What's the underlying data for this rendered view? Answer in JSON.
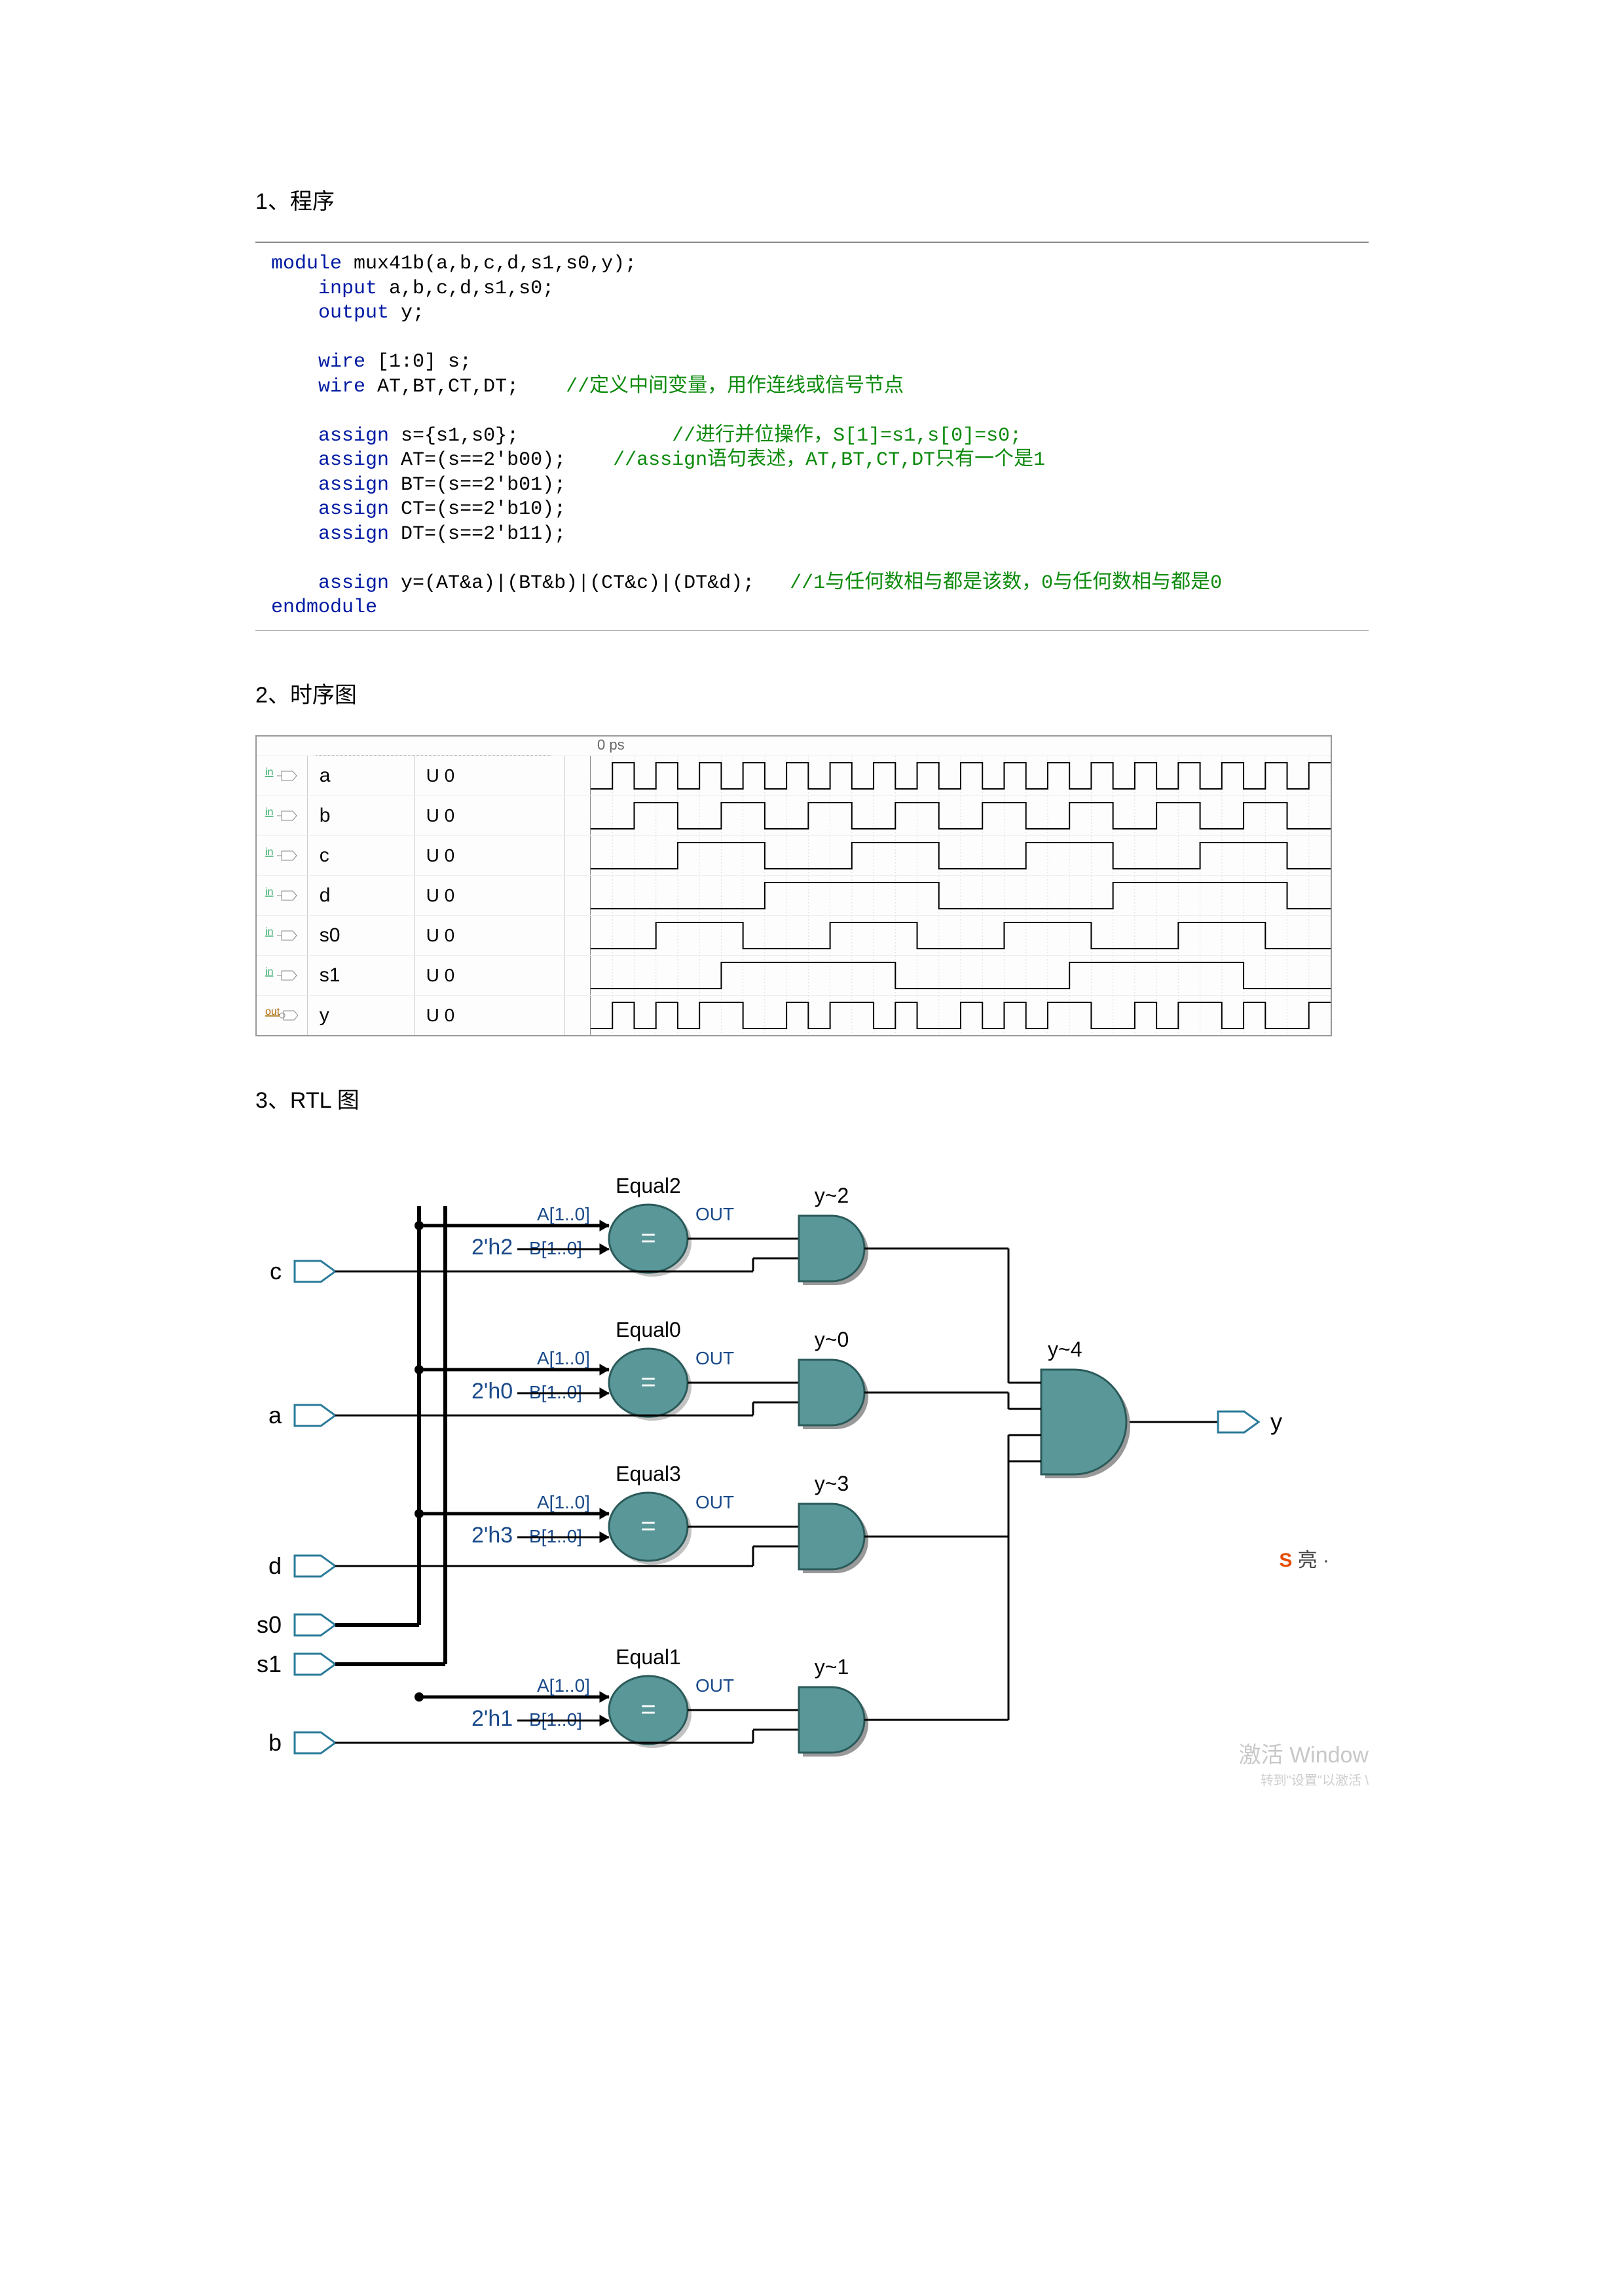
{
  "sections": {
    "s1": "1、程序",
    "s2": "2、时序图",
    "s3": "3、RTL 图"
  },
  "code": {
    "l1a": "module",
    "l1b": " mux41b(a,b,c,d,s1,s0,y);",
    "l2a": "input",
    "l2b": " a,b,c,d,s1,s0;",
    "l3a": "output",
    "l3b": " y;",
    "l4a": "wire",
    "l4b": " [1:0] s;",
    "l5a": "wire",
    "l5b": " AT,BT,CT,DT;    ",
    "l5c": "//定义中间变量，用作连线或信号节点",
    "l6a": "assign",
    "l6b": " s={s1,s0};             ",
    "l6c": "//进行并位操作，S[1]=s1,s[0]=s0;",
    "l7a": "assign",
    "l7b": " AT=(s==2'b00);    ",
    "l7c": "//assign语句表述，AT,BT,CT,DT只有一个是1",
    "l8a": "assign",
    "l8b": " BT=(s==2'b01);",
    "l9a": "assign",
    "l9b": " CT=(s==2'b10);",
    "l10a": "assign",
    "l10b": " DT=(s==2'b11);",
    "l11a": "assign",
    "l11b": " y=(AT&a)|(BT&b)|(CT&c)|(DT&d);   ",
    "l11c": "//1与任何数相与都是该数，0与任何数相与都是0",
    "l12": "endmodule"
  },
  "wave": {
    "time_label": "0 ps",
    "rows": [
      {
        "kind": "in",
        "name": "a",
        "val": "U 0",
        "period": 1,
        "phase": 0
      },
      {
        "kind": "in",
        "name": "b",
        "val": "U 0",
        "period": 2,
        "phase": 0
      },
      {
        "kind": "in",
        "name": "c",
        "val": "U 0",
        "period": 4,
        "phase": 0
      },
      {
        "kind": "in",
        "name": "d",
        "val": "U 0",
        "period": 8,
        "phase": 0
      },
      {
        "kind": "in",
        "name": "s0",
        "val": "U 0",
        "period": 4,
        "phase": 1
      },
      {
        "kind": "in",
        "name": "s1",
        "val": "U 0",
        "period": 8,
        "phase": 2
      },
      {
        "kind": "out",
        "name": "y",
        "val": "U 0",
        "pattern": "0101011001011010010101100101101001"
      }
    ]
  },
  "rtl": {
    "inputs": [
      "c",
      "a",
      "d",
      "s0",
      "s1",
      "b"
    ],
    "output": "y",
    "eq_nodes": [
      {
        "name": "Equal2",
        "const": "2'h2"
      },
      {
        "name": "Equal0",
        "const": "2'h0"
      },
      {
        "name": "Equal3",
        "const": "2'h3"
      },
      {
        "name": "Equal1",
        "const": "2'h1"
      }
    ],
    "and_nodes": [
      "y~2",
      "y~0",
      "y~3",
      "y~1"
    ],
    "final_and": "y~4",
    "port_a": "A[1..0]",
    "port_b": "B[1..0]",
    "port_out": "OUT"
  },
  "badge": {
    "text": "亮 ·"
  },
  "watermark": {
    "main": "激活 Window",
    "sub": "转到\"设置\"以激活 \\"
  }
}
